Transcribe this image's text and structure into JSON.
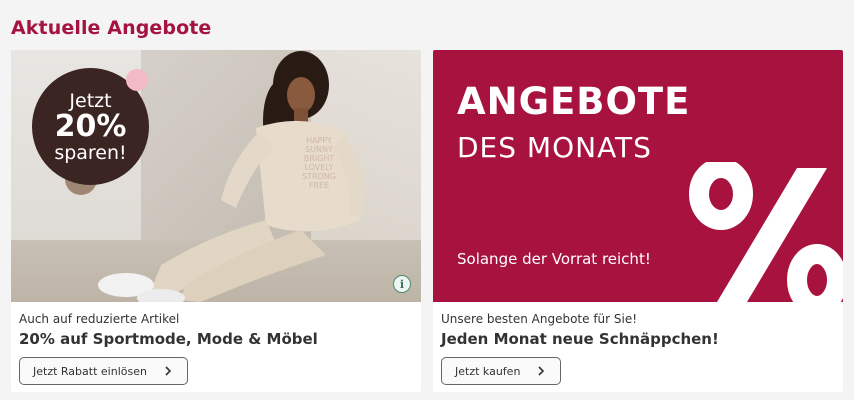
{
  "section": {
    "title": "Aktuelle Angebote"
  },
  "cards": [
    {
      "badge": {
        "line1": "Jetzt",
        "line2": "20%",
        "line3": "sparen!"
      },
      "shirt_text": [
        "HAPPY",
        "SUNNY",
        "BRIGHT",
        "LOVELY",
        "STRONG",
        "FREE"
      ],
      "info_icon": "i",
      "subline": "Auch auf reduzierte Artikel",
      "headline": "20% auf Sportmode, Mode & Möbel",
      "button_label": "Jetzt Rabatt einlösen"
    },
    {
      "promo": {
        "title": "ANGEBOTE",
        "subtitle": "DES MONATS",
        "note": "Solange der Vorrat reicht!",
        "symbol": "%"
      },
      "subline": "Unsere besten Angebote für Sie!",
      "headline": "Jeden Monat neue Schnäppchen!",
      "button_label": "Jetzt kaufen"
    }
  ],
  "colors": {
    "accent": "#a5133f",
    "promo_bg": "#a8123f",
    "badge_bg": "#3b2523",
    "page_bg": "#f4f4f5"
  },
  "icons": {
    "button": "chevron-right-icon",
    "info": "info-icon"
  }
}
